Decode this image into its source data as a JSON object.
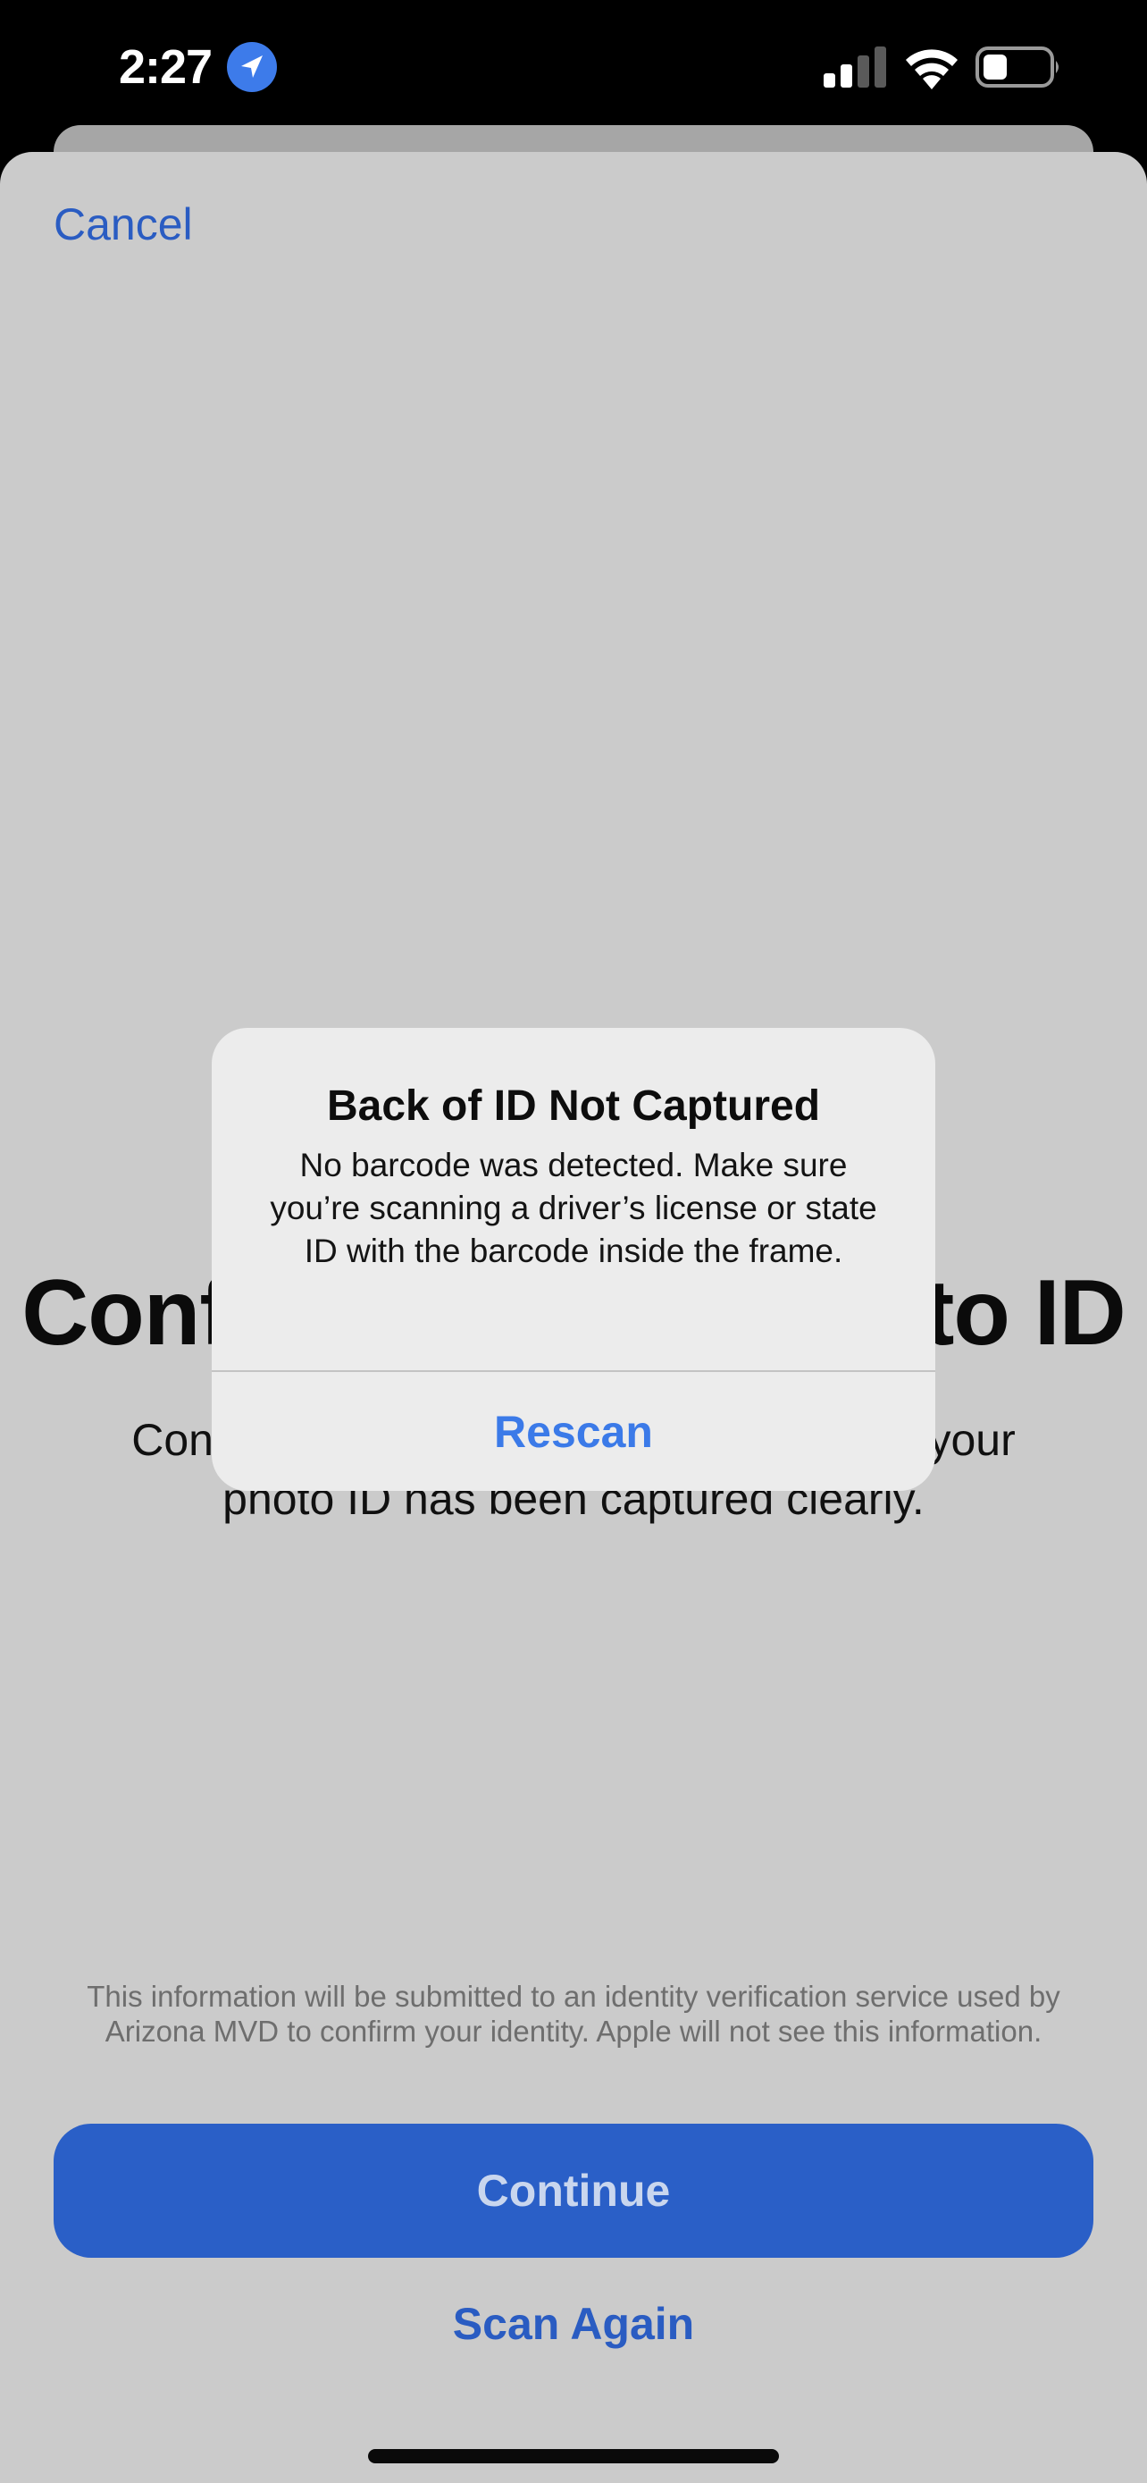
{
  "status_bar": {
    "time": "2:27",
    "icons": [
      "location-arrow-icon",
      "cellular-signal-icon",
      "wifi-icon",
      "battery-icon"
    ]
  },
  "nav": {
    "cancel_label": "Cancel"
  },
  "main": {
    "heading": "Confirm Back of Photo ID",
    "description": "Confirm that the barcode on the back of your photo ID has been captured clearly."
  },
  "footer": {
    "disclaimer": "This information will be submitted to an identity verification service used by Arizona MVD to confirm your identity. Apple will not see this information.",
    "continue_label": "Continue",
    "scan_again_label": "Scan Again"
  },
  "alert": {
    "title": "Back of ID Not Captured",
    "message": "No barcode was detected. Make sure you’re scanning a driver’s license or state ID with the barcode inside the frame.",
    "button_label": "Rescan"
  },
  "colors": {
    "accent": "#2a5cc2",
    "alert_button": "#3b7ae8",
    "sheet_background": "#cbcbcb",
    "alert_background": "#ececec",
    "status_bar_background": "#000000"
  }
}
